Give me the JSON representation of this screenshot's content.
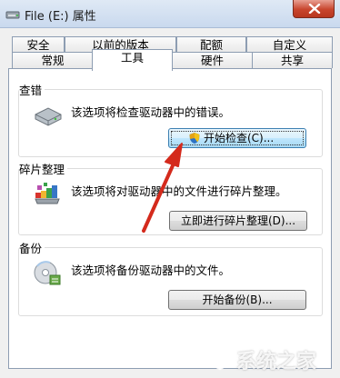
{
  "window": {
    "title": "File (E:) 属性"
  },
  "tabs_back": [
    "安全",
    "以前的版本",
    "配额",
    "自定义"
  ],
  "tabs_front": [
    "常规",
    "工具",
    "硬件",
    "共享"
  ],
  "active_tab": "工具",
  "sections": {
    "check": {
      "title": "查错",
      "desc": "该选项将检查驱动器中的错误。",
      "button": "开始检查(C)..."
    },
    "defrag": {
      "title": "碎片整理",
      "desc": "该选项将对驱动器中的文件进行碎片整理。",
      "button": "立即进行碎片整理(D)..."
    },
    "backup": {
      "title": "备份",
      "desc": "该选项将备份驱动器中的文件。",
      "button": "开始备份(B)..."
    }
  },
  "watermark": "系统之家",
  "colors": {
    "arrow": "#d42a1c",
    "accent": "#3c7fb1"
  }
}
